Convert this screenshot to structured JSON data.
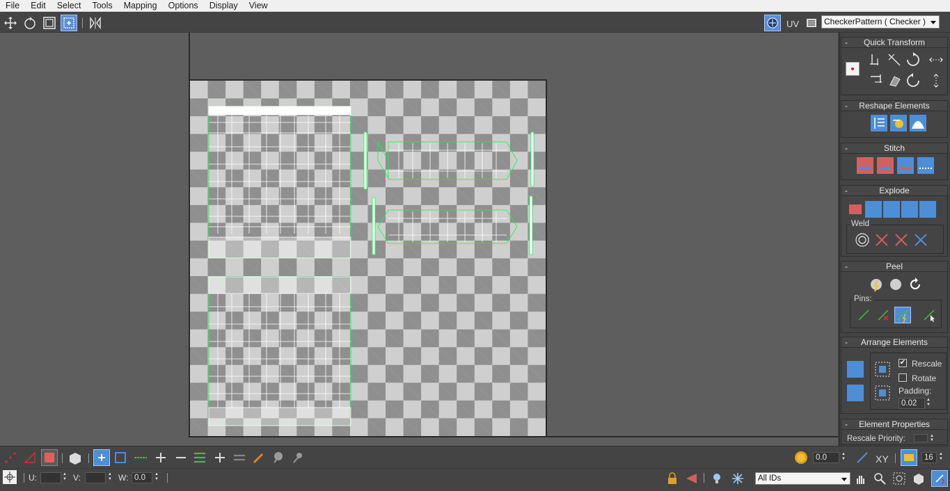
{
  "menu": {
    "items": [
      "File",
      "Edit",
      "Select",
      "Tools",
      "Mapping",
      "Options",
      "Display",
      "View"
    ]
  },
  "toolbar": {
    "uv_label": "UV",
    "map_select": "CheckerPattern  ( Checker )",
    "icons": [
      "move-icon",
      "rotate-icon",
      "scale-icon",
      "freeform-icon",
      "mirror-icon"
    ]
  },
  "panel": {
    "quick_transform": {
      "title": "Quick Transform",
      "collapse": "-"
    },
    "reshape": {
      "title": "Reshape Elements",
      "collapse": "-"
    },
    "stitch": {
      "title": "Stitch",
      "collapse": "-"
    },
    "explode": {
      "title": "Explode",
      "collapse": "-",
      "weld_label": "Weld"
    },
    "peel": {
      "title": "Peel",
      "collapse": "-",
      "pins_label": "Pins:"
    },
    "arrange": {
      "title": "Arrange Elements",
      "collapse": "-",
      "rescale_label": "Rescale",
      "rescale_checked": true,
      "rotate_label": "Rotate",
      "rotate_checked": false,
      "padding_label": "Padding:",
      "padding_value": "0.02"
    },
    "element_props": {
      "title": "Element Properties",
      "collapse": "-",
      "rescale_priority_label": "Rescale Priority:"
    }
  },
  "bottom": {
    "soft_value": "0.0",
    "xy_label": "XY",
    "zoom_value": "16",
    "u_label": "U:",
    "v_label": "V:",
    "w_label": "W:",
    "w_value": "0.0",
    "ids_select": "All IDs"
  },
  "colors": {
    "accent_blue": "#5a8fd8",
    "uv_green": "#00ff40",
    "checker_dark": "#8f8f8f",
    "checker_light": "#cfcfcf"
  }
}
